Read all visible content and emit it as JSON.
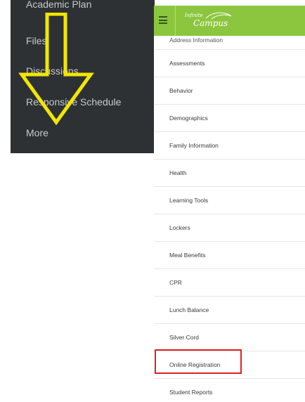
{
  "side_menu": {
    "items": [
      {
        "label": "Academic Plan"
      },
      {
        "label": "Files"
      },
      {
        "label": "Discussions"
      },
      {
        "label": "Responsive Schedule"
      },
      {
        "label": "More"
      }
    ],
    "background": "#2d3133",
    "text_color": "#c7cacb"
  },
  "arrow": {
    "icon": "down-arrow-icon",
    "color": "#f2e600"
  },
  "header": {
    "menu_icon": "hamburger-icon",
    "logo_top": "Infinite",
    "logo_main": "Campus",
    "background": "#8cc63f"
  },
  "menu": {
    "items": [
      {
        "label": "Address Information"
      },
      {
        "label": "Assessments"
      },
      {
        "label": "Behavior"
      },
      {
        "label": "Demographics"
      },
      {
        "label": "Family Information"
      },
      {
        "label": "Health"
      },
      {
        "label": "Learning Tools"
      },
      {
        "label": "Lockers"
      },
      {
        "label": "Meal Benefits"
      },
      {
        "label": "CPR"
      },
      {
        "label": "Lunch Balance"
      },
      {
        "label": "Silver Cord"
      },
      {
        "label": "Online Registration"
      },
      {
        "label": "Student Reports"
      }
    ],
    "highlighted": "Online Registration",
    "highlight_color": "#e02020"
  }
}
